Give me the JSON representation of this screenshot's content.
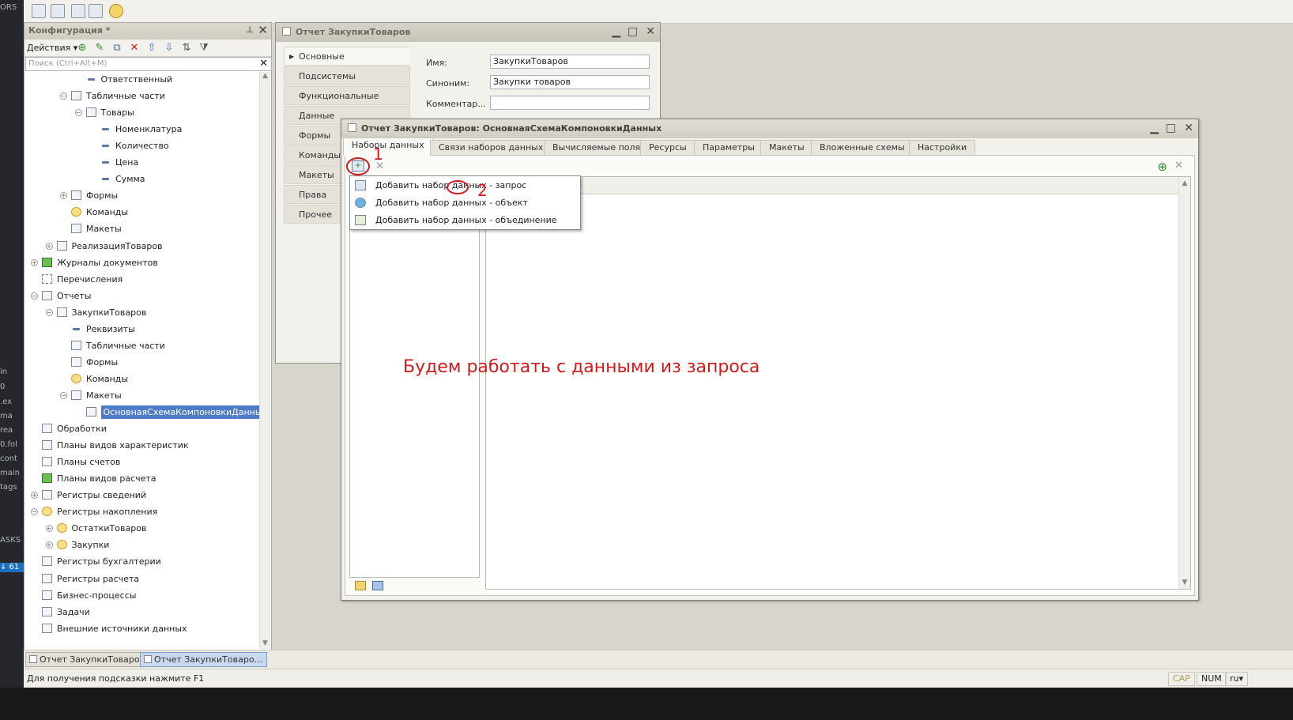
{
  "left_strip": {
    "items": [
      "ORS",
      "in",
      "0",
      ".ex",
      "ma",
      "rea",
      "0.fol",
      "cont",
      "main",
      "tags",
      "ASKS",
      "↓ 61"
    ]
  },
  "config": {
    "title": "Конфигурация *",
    "actions_label": "Действия",
    "search_placeholder": "Поиск (Ctrl+Alt+M)",
    "tree": [
      {
        "label": "Ответственный",
        "level": 4,
        "icon": "attribute-icon",
        "toggle": ""
      },
      {
        "label": "Табличные части",
        "level": 3,
        "icon": "table-icon",
        "toggle": "⊖"
      },
      {
        "label": "Товары",
        "level": 4,
        "icon": "table-icon",
        "toggle": "⊖"
      },
      {
        "label": "Номенклатура",
        "level": 5,
        "icon": "attribute-icon",
        "toggle": ""
      },
      {
        "label": "Количество",
        "level": 5,
        "icon": "attribute-icon",
        "toggle": ""
      },
      {
        "label": "Цена",
        "level": 5,
        "icon": "attribute-icon",
        "toggle": ""
      },
      {
        "label": "Сумма",
        "level": 5,
        "icon": "attribute-icon",
        "toggle": ""
      },
      {
        "label": "Формы",
        "level": 3,
        "icon": "form-icon",
        "toggle": "⊕"
      },
      {
        "label": "Команды",
        "level": 3,
        "icon": "command-icon",
        "toggle": ""
      },
      {
        "label": "Макеты",
        "level": 3,
        "icon": "layout-icon",
        "toggle": ""
      },
      {
        "label": "РеализацияТоваров",
        "level": 2,
        "icon": "document-icon",
        "toggle": "⊕"
      },
      {
        "label": "Журналы документов",
        "level": 1,
        "icon": "journal-icon",
        "toggle": "⊕"
      },
      {
        "label": "Перечисления",
        "level": 1,
        "icon": "enum-icon",
        "toggle": ""
      },
      {
        "label": "Отчеты",
        "level": 1,
        "icon": "report-icon",
        "toggle": "⊖"
      },
      {
        "label": "ЗакупкиТоваров",
        "level": 2,
        "icon": "report-icon",
        "toggle": "⊖"
      },
      {
        "label": "Реквизиты",
        "level": 3,
        "icon": "attribute-icon",
        "toggle": ""
      },
      {
        "label": "Табличные части",
        "level": 3,
        "icon": "table-icon",
        "toggle": ""
      },
      {
        "label": "Формы",
        "level": 3,
        "icon": "form-icon",
        "toggle": ""
      },
      {
        "label": "Команды",
        "level": 3,
        "icon": "command-icon",
        "toggle": ""
      },
      {
        "label": "Макеты",
        "level": 3,
        "icon": "layout-icon",
        "toggle": "⊖"
      },
      {
        "label": "ОсновнаяСхемаКомпоновкиДанных",
        "level": 4,
        "icon": "layout-icon",
        "toggle": "",
        "selected": true
      },
      {
        "label": "Обработки",
        "level": 1,
        "icon": "processing-icon",
        "toggle": ""
      },
      {
        "label": "Планы видов характеристик",
        "level": 1,
        "icon": "chart-of-characteristics-icon",
        "toggle": ""
      },
      {
        "label": "Планы счетов",
        "level": 1,
        "icon": "chart-of-accounts-icon",
        "toggle": ""
      },
      {
        "label": "Планы видов расчета",
        "level": 1,
        "icon": "calculation-types-icon",
        "toggle": ""
      },
      {
        "label": "Регистры сведений",
        "level": 1,
        "icon": "info-register-icon",
        "toggle": "⊕"
      },
      {
        "label": "Регистры накопления",
        "level": 1,
        "icon": "accumulation-register-icon",
        "toggle": "⊖"
      },
      {
        "label": "ОстаткиТоваров",
        "level": 2,
        "icon": "accumulation-register-icon",
        "toggle": "⊕"
      },
      {
        "label": "Закупки",
        "level": 2,
        "icon": "accumulation-register-icon",
        "toggle": "⊕"
      },
      {
        "label": "Регистры бухгалтерии",
        "level": 1,
        "icon": "accounting-register-icon",
        "toggle": ""
      },
      {
        "label": "Регистры расчета",
        "level": 1,
        "icon": "calculation-register-icon",
        "toggle": ""
      },
      {
        "label": "Бизнес-процессы",
        "level": 1,
        "icon": "business-process-icon",
        "toggle": ""
      },
      {
        "label": "Задачи",
        "level": 1,
        "icon": "task-icon",
        "toggle": ""
      },
      {
        "label": "Внешние источники данных",
        "level": 1,
        "icon": "external-source-icon",
        "toggle": ""
      }
    ]
  },
  "report_window": {
    "title": "Отчет ЗакупкиТоваров",
    "tabs": [
      "Основные",
      "Подсистемы",
      "Функциональные опции",
      "Данные",
      "Формы",
      "Команды",
      "Макеты",
      "Права",
      "Прочее"
    ],
    "active_tab": "Основные",
    "fields": [
      {
        "label": "Имя:",
        "value": "ЗакупкиТоваров"
      },
      {
        "label": "Синоним:",
        "value": "Закупки товаров"
      },
      {
        "label": "Комментар...",
        "value": ""
      }
    ]
  },
  "schema_window": {
    "title": "Отчет ЗакупкиТоваров: ОсновнаяСхемаКомпоновкиДанных",
    "tabs": [
      "Наборы данных",
      "Связи наборов данных",
      "Вычисляемые поля",
      "Ресурсы",
      "Параметры",
      "Макеты",
      "Вложенные схемы",
      "Настройки"
    ],
    "active_tab": "Наборы данных",
    "dropdown": [
      {
        "label": "Добавить набор данных - запрос",
        "icon": "query-dataset-icon"
      },
      {
        "label": "Добавить набор данных - объект",
        "icon": "object-dataset-icon"
      },
      {
        "label": "Добавить набор данных - объединение",
        "icon": "union-dataset-icon"
      }
    ],
    "partial_header": "к",
    "annotation": "Будем работать с данными из запроса",
    "marker1": "1",
    "marker2": "2"
  },
  "window_tabs": [
    "Отчет ЗакупкиТоваров",
    "Отчет ЗакупкиТоваро..."
  ],
  "status": {
    "hint": "Для получения подсказки нажмите F1",
    "cap": "CAP",
    "num": "NUM",
    "lang": "ru"
  },
  "colors": {
    "annotation": "#d11a1a",
    "selection": "#4e7cc9"
  }
}
